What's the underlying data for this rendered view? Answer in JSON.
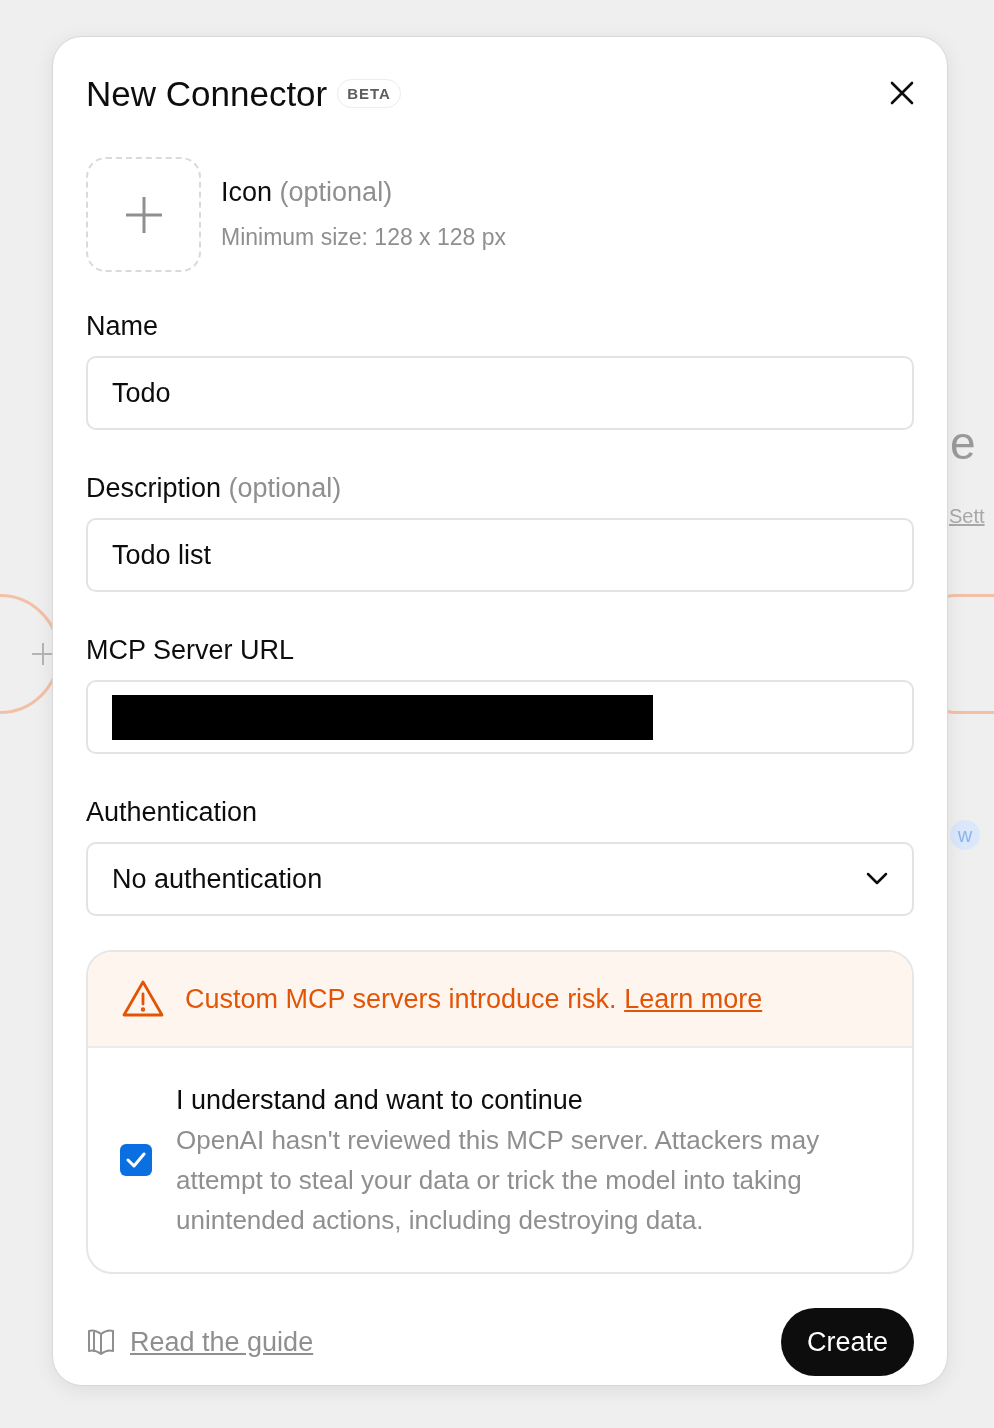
{
  "background": {
    "heading_fragment": "e",
    "link_fragment": "Sett",
    "badge_fragment": "w"
  },
  "dialog": {
    "title": "New Connector",
    "badge": "BETA",
    "icon_upload": {
      "label": "Icon",
      "optional": "(optional)",
      "hint": "Minimum size: 128 x 128 px"
    },
    "fields": [
      {
        "kind": "text",
        "label": "Name",
        "value": "Todo"
      },
      {
        "kind": "text",
        "label": "Description",
        "optional": "(optional)",
        "value": "Todo list"
      },
      {
        "kind": "redacted",
        "label": "MCP Server URL"
      },
      {
        "kind": "select",
        "label": "Authentication",
        "value": "No authentication"
      }
    ],
    "warning": {
      "message": "Custom MCP servers introduce risk.",
      "link": "Learn more"
    },
    "consent": {
      "checked": true,
      "title": "I understand and want to continue",
      "body": "OpenAI hasn't reviewed this MCP server. Attackers may attempt to steal your data or trick the model into taking unintended actions, including destroying data."
    },
    "guide_link": "Read the guide",
    "primary_button": "Create"
  }
}
